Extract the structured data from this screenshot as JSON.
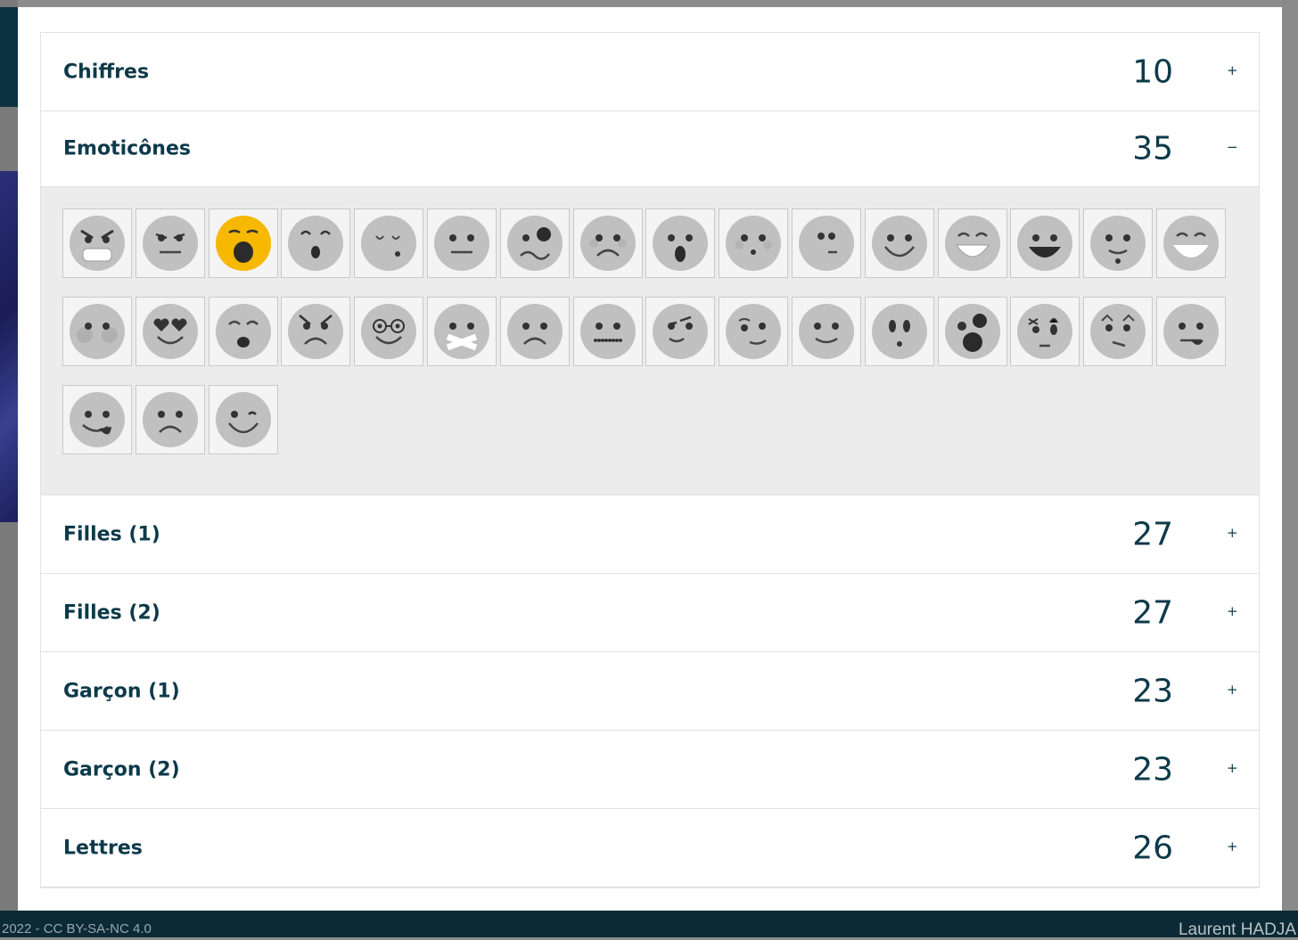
{
  "footer": {
    "left_text": "2022 - CC BY-SA-NC 4.0",
    "right_text": "Laurent HADJA"
  },
  "accordion": {
    "colors": {
      "text": "#0d3a4a",
      "open_body": "#ececec",
      "face": "#c0c0c0",
      "selected_face": "#f6b800"
    },
    "sections": [
      {
        "title": "Chiffres",
        "count": "10",
        "toggle": "+",
        "open": false
      },
      {
        "title": "Emoticônes",
        "count": "35",
        "toggle": "−",
        "open": true
      },
      {
        "title": "Filles (1)",
        "count": "27",
        "toggle": "+",
        "open": false
      },
      {
        "title": "Filles (2)",
        "count": "27",
        "toggle": "+",
        "open": false
      },
      {
        "title": "Garçon (1)",
        "count": "23",
        "toggle": "+",
        "open": false
      },
      {
        "title": "Garçon (2)",
        "count": "23",
        "toggle": "+",
        "open": false
      },
      {
        "title": "Lettres",
        "count": "26",
        "toggle": "+",
        "open": false
      }
    ],
    "emoticons": [
      "angry-grin",
      "annoyed",
      "yawn",
      "surprised-brow",
      "sleeping",
      "neutral",
      "confused",
      "sad-blush",
      "shocked",
      "blush",
      "bored",
      "smile",
      "grin-teeth",
      "laugh",
      "drool",
      "big-smile",
      "blushing-cheeks",
      "heart-eyes",
      "kiss",
      "angry",
      "glasses",
      "mouth-taped",
      "sad",
      "zipped-mouth",
      "smirk",
      "skeptical",
      "content",
      "surprised-eyes",
      "astonished",
      "suspicious",
      "worried",
      "tongue-side",
      "tongue-out",
      "frown",
      "wink"
    ],
    "selected_emoticon": 2
  }
}
